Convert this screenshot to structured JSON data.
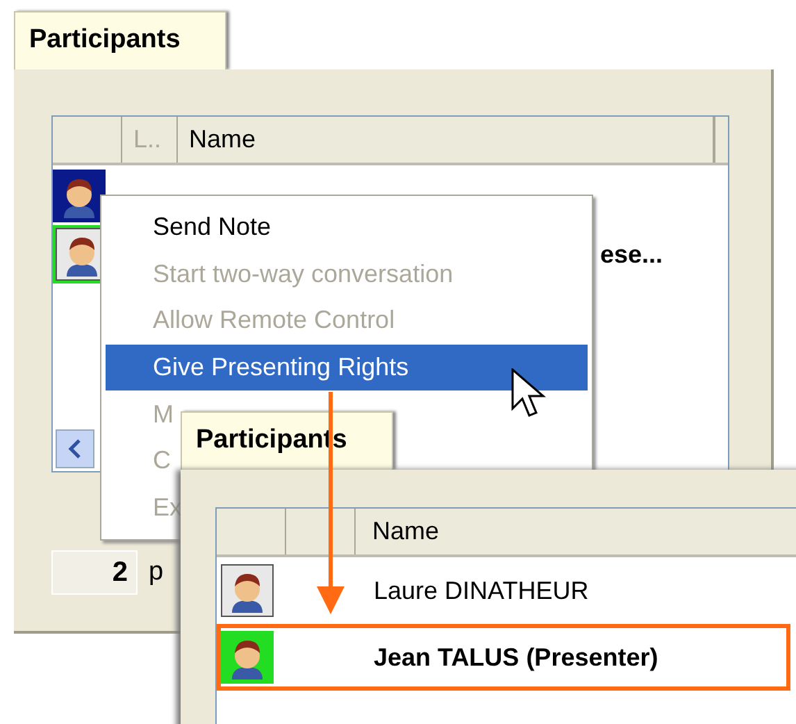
{
  "back_panel": {
    "tab": "Participants",
    "columns": [
      {
        "label": "L..",
        "disabled": true
      },
      {
        "label": "Name",
        "disabled": false
      }
    ],
    "rows": [
      {
        "selected": true,
        "presenter": false
      },
      {
        "name": "ese...",
        "selected": false,
        "presenter": true
      }
    ],
    "count": "2",
    "count_label": "p"
  },
  "context_menu": {
    "items": [
      {
        "label": "Send Note",
        "disabled": false,
        "selected": false
      },
      {
        "label": "Start two-way conversation",
        "disabled": true,
        "selected": false
      },
      {
        "label": "Allow Remote Control",
        "disabled": true,
        "selected": false
      },
      {
        "label": "Give Presenting Rights",
        "disabled": false,
        "selected": true
      },
      {
        "label": "M",
        "disabled": true,
        "selected": false
      },
      {
        "label": "C",
        "disabled": true,
        "selected": false
      },
      {
        "label": "Ex",
        "disabled": true,
        "selected": false
      }
    ]
  },
  "front_panel": {
    "tab": "Participants",
    "columns": [
      {
        "label": "Name",
        "disabled": false
      }
    ],
    "rows": [
      {
        "name": "Laure DINATHEUR",
        "presenter": false,
        "highlighted": false
      },
      {
        "name": "Jean TALUS (Presenter)",
        "presenter": true,
        "highlighted": true
      }
    ]
  }
}
